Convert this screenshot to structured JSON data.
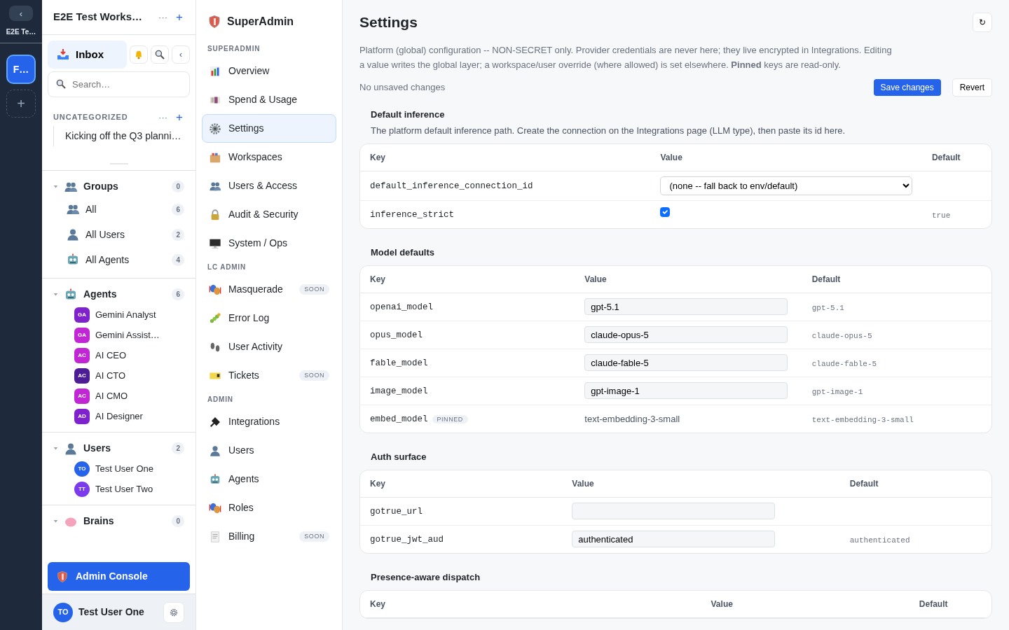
{
  "rail": {
    "collapse": "‹",
    "workspace_label": "E2E Te…",
    "workspaces": [
      {
        "label": "F…",
        "selected": true
      }
    ],
    "add": "+"
  },
  "sidebar": {
    "title": "E2E Test Works…",
    "more": "···",
    "add": "+",
    "inbox": {
      "label": "Inbox",
      "selected": true
    },
    "collapse": "‹",
    "search": {
      "placeholder": "Search…"
    },
    "uncategorized": {
      "title": "UNCATEGORIZED",
      "more": "···",
      "add": "+",
      "items": [
        "Kicking off the Q3 planni…"
      ]
    },
    "sections": [
      {
        "title": "Groups",
        "count": "0",
        "expanded": true,
        "items": [
          {
            "kind": "group",
            "label": "All",
            "count": "6"
          },
          {
            "kind": "group",
            "label": "All Users",
            "count": "2"
          },
          {
            "kind": "group",
            "label": "All Agents",
            "count": "4"
          }
        ]
      },
      {
        "title": "Agents",
        "count": "6",
        "expanded": true,
        "items": [
          {
            "kind": "member",
            "initials": "GA",
            "label": "Gemini Analyst",
            "color": "#7e22ce"
          },
          {
            "kind": "member",
            "initials": "GA",
            "label": "Gemini Assist…",
            "color": "#c026d3"
          },
          {
            "kind": "member",
            "initials": "AC",
            "label": "AI CEO",
            "color": "#c026d3"
          },
          {
            "kind": "member",
            "initials": "AC",
            "label": "AI CTO",
            "color": "#4c1d95"
          },
          {
            "kind": "member",
            "initials": "AC",
            "label": "AI CMO",
            "color": "#c026d3"
          },
          {
            "kind": "member",
            "initials": "AD",
            "label": "AI Designer",
            "color": "#7e22ce"
          }
        ]
      },
      {
        "title": "Users",
        "count": "2",
        "expanded": true,
        "items": [
          {
            "kind": "member",
            "initials": "TO",
            "label": "Test User One",
            "color": "#2563eb"
          },
          {
            "kind": "member",
            "initials": "TT",
            "label": "Test User Two",
            "color": "#7c3aed"
          }
        ]
      },
      {
        "title": "Brains",
        "count": "0",
        "expanded": true
      }
    ],
    "admin_button": "Admin Console",
    "user": {
      "initials": "TO",
      "name": "Test User One"
    }
  },
  "admin_nav": {
    "brand": "SuperAdmin",
    "groups": [
      {
        "title": "SUPERADMIN",
        "items": [
          {
            "label": "Overview",
            "selected": false
          },
          {
            "label": "Spend & Usage",
            "selected": false
          },
          {
            "label": "Settings",
            "selected": true
          },
          {
            "label": "Workspaces",
            "selected": false
          },
          {
            "label": "Users & Access",
            "selected": false
          },
          {
            "label": "Audit & Security",
            "selected": false
          },
          {
            "label": "System / Ops",
            "selected": false
          }
        ]
      },
      {
        "title": "LC ADMIN",
        "items": [
          {
            "label": "Masquerade",
            "selected": false,
            "badge": "SOON"
          },
          {
            "label": "Error Log",
            "selected": false
          },
          {
            "label": "User Activity",
            "selected": false
          },
          {
            "label": "Tickets",
            "selected": false,
            "badge": "SOON"
          }
        ]
      },
      {
        "title": "ADMIN",
        "items": [
          {
            "label": "Integrations",
            "selected": false
          },
          {
            "label": "Users",
            "selected": false
          },
          {
            "label": "Agents",
            "selected": false
          },
          {
            "label": "Roles",
            "selected": false
          },
          {
            "label": "Billing",
            "selected": false,
            "badge": "SOON"
          }
        ]
      }
    ]
  },
  "main": {
    "title": "Settings",
    "refresh": "↻",
    "description": "Platform (global) configuration -- NON-SECRET only. Provider credentials are never here; they live encrypted in Integrations. Editing a value writes the global layer; a workspace/user override (where allowed) is set elsewhere. **Pinned** keys are read-only.",
    "status": "No unsaved changes",
    "save": "Save changes",
    "revert": "Revert",
    "sections": [
      {
        "title": "Default inference",
        "description": "The platform default inference path. Create the connection on the Integrations page (LLM type), then paste its id here.",
        "columns": [
          "Key",
          "Value",
          "Default"
        ],
        "rows": [
          {
            "key": "default_inference_connection_id",
            "kind": "select",
            "value": "(none -- fall back to env/default)"
          },
          {
            "key": "inference_strict",
            "kind": "checkbox",
            "checked": true,
            "default": "true"
          }
        ]
      },
      {
        "title": "Model defaults",
        "columns": [
          "Key",
          "Value",
          "Default"
        ],
        "rows": [
          {
            "key": "openai_model",
            "kind": "text",
            "value": "gpt-5.1",
            "default": "gpt-5.1"
          },
          {
            "key": "opus_model",
            "kind": "text",
            "value": "claude-opus-5",
            "default": "claude-opus-5"
          },
          {
            "key": "fable_model",
            "kind": "text",
            "value": "claude-fable-5",
            "default": "claude-fable-5"
          },
          {
            "key": "image_model",
            "kind": "text",
            "value": "gpt-image-1",
            "default": "gpt-image-1"
          },
          {
            "key": "embed_model",
            "kind": "pinned",
            "badge": "PINNED",
            "value": "text-embedding-3-small",
            "default": "text-embedding-3-small"
          }
        ]
      },
      {
        "title": "Auth surface",
        "columns": [
          "Key",
          "Value",
          "Default"
        ],
        "rows": [
          {
            "key": "gotrue_url",
            "kind": "text"
          },
          {
            "key": "gotrue_jwt_aud",
            "kind": "text",
            "value": "authenticated",
            "default": "authenticated"
          }
        ]
      },
      {
        "title": "Presence-aware dispatch",
        "columns": [
          "Key",
          "Value",
          "Default"
        ]
      }
    ]
  }
}
